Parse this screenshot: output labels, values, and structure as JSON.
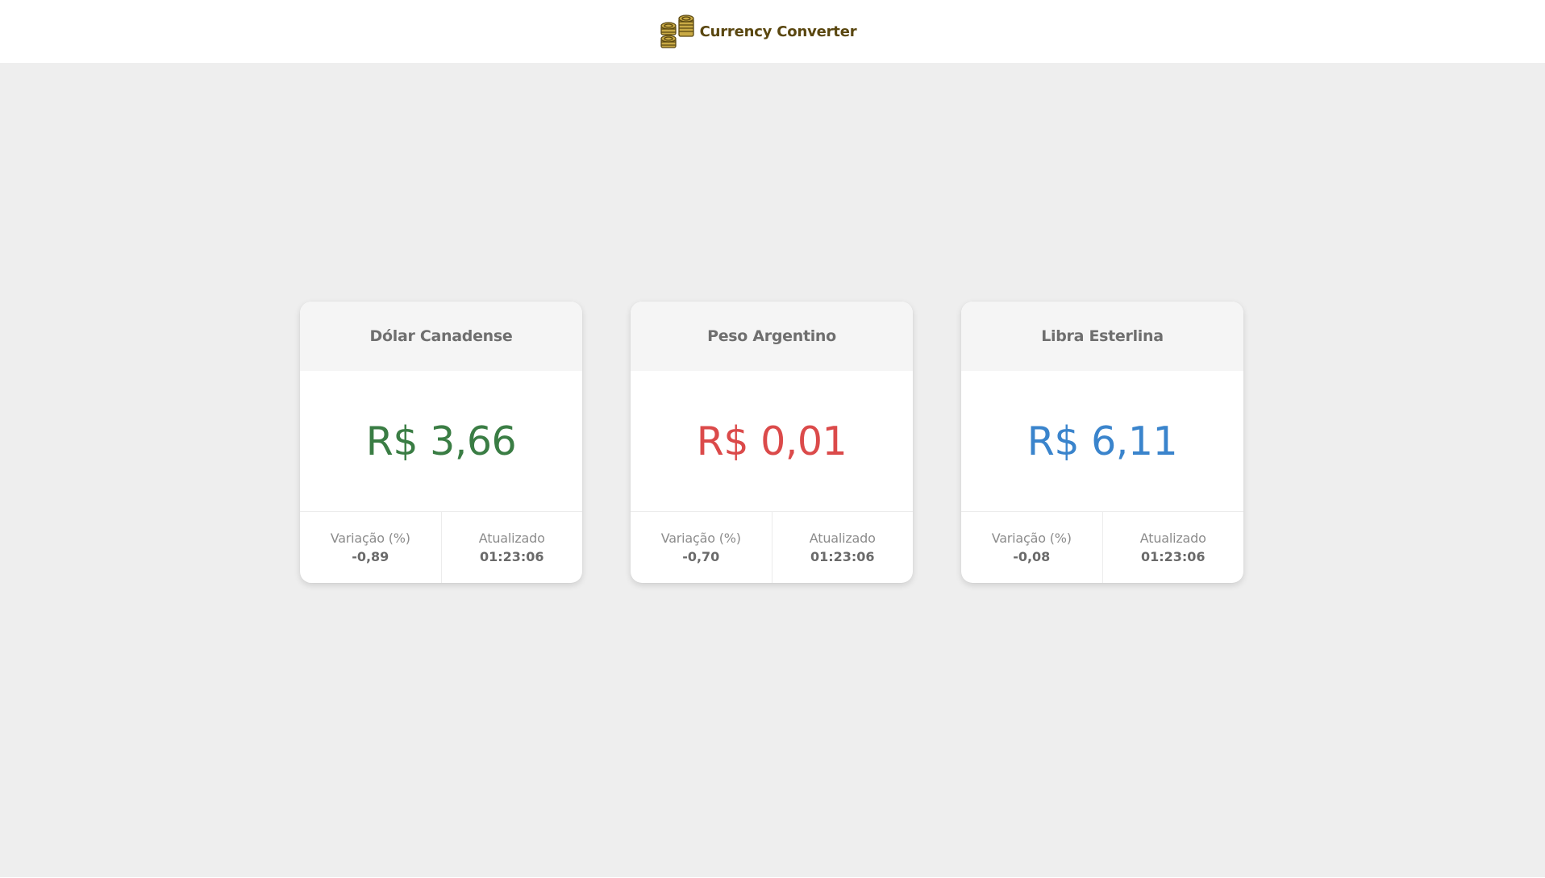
{
  "header": {
    "title": "Currency Converter",
    "logo_icon": "coins-icon",
    "logo_color": "#8a7420"
  },
  "cards": [
    {
      "title": "Dólar Canadense",
      "value": "R$ 3,66",
      "value_color": "#3a7d44",
      "variation_label": "Variação (%)",
      "variation_value": "-0,89",
      "updated_label": "Atualizado",
      "updated_value": "01:23:06"
    },
    {
      "title": "Peso Argentino",
      "value": "R$ 0,01",
      "value_color": "#db4a4a",
      "variation_label": "Variação (%)",
      "variation_value": "-0,70",
      "updated_label": "Atualizado",
      "updated_value": "01:23:06"
    },
    {
      "title": "Libra Esterlina",
      "value": "R$ 6,11",
      "value_color": "#3a84cc",
      "variation_label": "Variação (%)",
      "variation_value": "-0,08",
      "updated_label": "Atualizado",
      "updated_value": "01:23:06"
    }
  ]
}
